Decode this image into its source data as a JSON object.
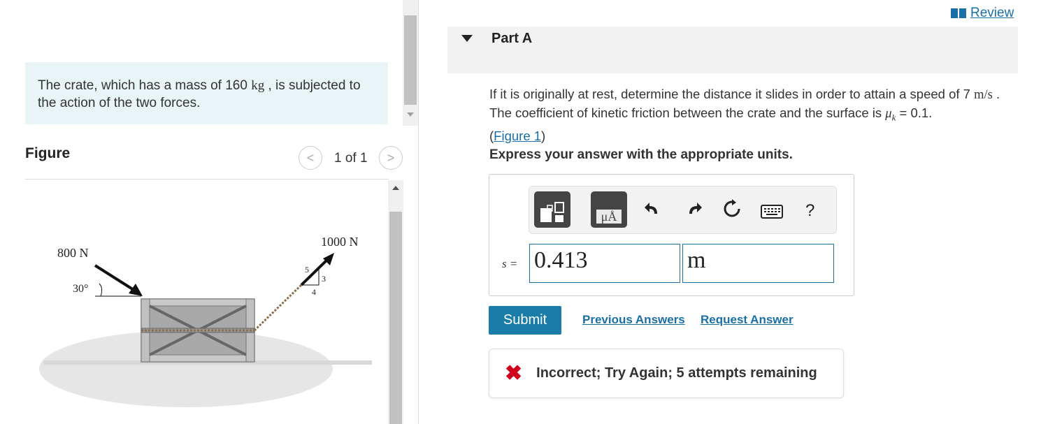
{
  "problem": {
    "text_part1": "The crate, which has a mass of 160 ",
    "mass_unit": "kg",
    "text_part2": " , is subjected to the action of the two forces."
  },
  "figure": {
    "title": "Figure",
    "pager": "1 of 1",
    "prev_glyph": "<",
    "next_glyph": ">",
    "labels": {
      "force_left": "800 N",
      "angle": "30°",
      "force_right": "1000 N",
      "ratio_hyp": "5",
      "ratio_vert": "3",
      "ratio_horiz": "4"
    }
  },
  "header": {
    "review_label": "Review"
  },
  "part": {
    "title": "Part A",
    "question_part1": "If it is originally at rest, determine the distance it slides in order to attain a speed of 7 ",
    "speed_unit": "m/s",
    "question_part2": " . The coefficient of kinetic friction between the crate and the surface is ",
    "mu_symbol": "μ",
    "mu_sub": "k",
    "question_part3": " = 0.1.",
    "figure_link": "Figure 1",
    "paren_open": "(",
    "paren_close": ")",
    "instruction": "Express your answer with the appropriate units."
  },
  "toolbar": {
    "units_label": "μÅ",
    "help_label": "?",
    "icons": [
      "templates-icon",
      "units-icon",
      "undo-icon",
      "redo-icon",
      "reset-icon",
      "keyboard-icon",
      "help-icon"
    ]
  },
  "answer": {
    "variable": "s =",
    "value": "0.413",
    "unit": "m"
  },
  "actions": {
    "submit": "Submit",
    "previous_answers": "Previous Answers",
    "request_answer": "Request Answer"
  },
  "feedback": {
    "icon": "✖",
    "text": "Incorrect; Try Again; 5 attempts remaining"
  },
  "colors": {
    "accent": "#1a6fa6",
    "submit": "#1a7ca8",
    "error": "#d0021b",
    "problem_bg": "#e8f4f6"
  }
}
